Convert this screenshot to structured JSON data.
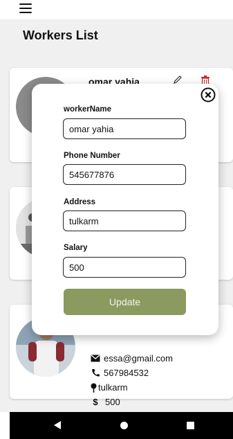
{
  "header": {
    "title": "Workers List"
  },
  "workers": [
    {
      "name": "omar yahia"
    },
    {
      "name": ""
    },
    {
      "email": "essa@gmail.com",
      "phone": "567984532",
      "address": "tulkarm",
      "salary": "500"
    }
  ],
  "dialog": {
    "fields": [
      {
        "label": "workerName",
        "value": "omar yahia"
      },
      {
        "label": "Phone Number",
        "value": "545677876"
      },
      {
        "label": "Address",
        "value": "tulkarm"
      },
      {
        "label": "Salary",
        "value": "500"
      }
    ],
    "update_label": "Update"
  },
  "icons": {
    "menu": "hamburger-menu-icon",
    "edit": "pencil-icon",
    "delete": "trash-icon",
    "close": "close-circle-icon",
    "email": "envelope-icon",
    "phone": "phone-icon",
    "address": "map-pin-icon",
    "salary": "dollar-icon"
  },
  "colors": {
    "accent": "#8b9a5f",
    "delete": "#cc2a2a",
    "background": "#f0f0f0"
  }
}
